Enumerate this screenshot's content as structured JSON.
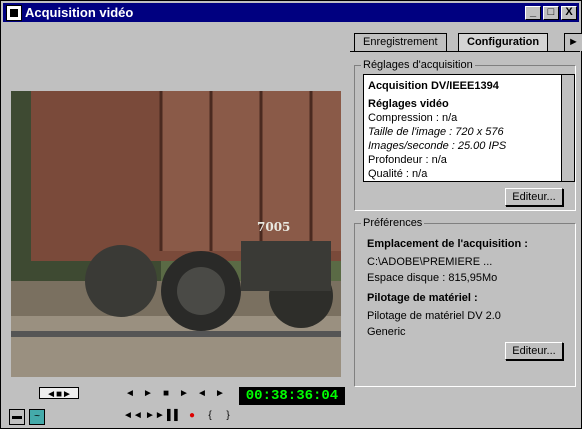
{
  "window": {
    "title": "Acquisition vidéo"
  },
  "titlebar": {
    "minimize": "_",
    "maximize": "□",
    "close": "X"
  },
  "tabs": [
    {
      "label": "Enregistrement"
    },
    {
      "label": "Configuration"
    }
  ],
  "acquisition": {
    "group_label": "Réglages d'acquisition",
    "lines": [
      "Acquisition DV/IEEE1394",
      "Réglages vidéo",
      "Compression : n/a",
      "Taille de l'image : 720 x 576",
      "Images/seconde : 25.00 IPS",
      "Profondeur : n/a",
      "Qualité : n/a"
    ],
    "edit_button": "Editeur..."
  },
  "preferences": {
    "group_label": "Préférences",
    "location_title": "Emplacement de l'acquisition :",
    "location_path": "C:\\ADOBE\\PREMIERE ...",
    "disk_space": "Espace disque : 815,95Mo",
    "device_title": "Pilotage de matériel :",
    "device_name": "Pilotage de matériel DV 2.0",
    "device_value": "Generic",
    "edit_button": "Editeur..."
  },
  "transport": {
    "timecode": "00:38:36:04"
  },
  "video": {
    "car_number": "7005"
  }
}
